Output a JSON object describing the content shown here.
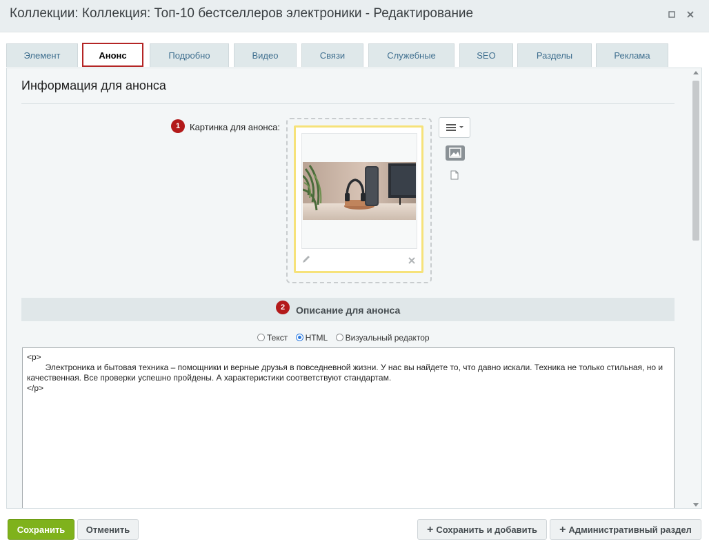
{
  "window": {
    "title": "Коллекции: Коллекция: Топ-10 бестселлеров электроники - Редактирование",
    "restore_glyph": "▫",
    "close_glyph": "✕"
  },
  "tabs": [
    {
      "label": "Элемент"
    },
    {
      "label": "Анонс",
      "active": true
    },
    {
      "label": "Подробно"
    },
    {
      "label": "Видео"
    },
    {
      "label": "Связи"
    },
    {
      "label": "Служебные"
    },
    {
      "label": "SEO"
    },
    {
      "label": "Разделы"
    },
    {
      "label": "Реклама"
    }
  ],
  "section": {
    "heading": "Информация для анонса",
    "picture": {
      "badge": "1",
      "label": "Картинка для анонса:",
      "image_description": "Наушники и колонка на столе"
    },
    "description": {
      "badge": "2",
      "title": "Описание для анонса",
      "modes": {
        "text": "Текст",
        "html": "HTML",
        "visual": "Визуальный редактор",
        "selected": "html"
      },
      "content": "<p>\n\tЭлектроника и бытовая техника – помощники и верные друзья в повседневной жизни. У нас вы найдете то, что давно искали. Техника не только стильная, но и качественная. Все проверки успешно пройдены. А характеристики соответствуют стандартам.\n</p>"
    }
  },
  "buttons": {
    "save": "Сохранить",
    "cancel": "Отменить",
    "save_and_add": "Сохранить и добавить",
    "admin_section": "Административный раздел"
  },
  "colors": {
    "accent_green": "#7fb21c",
    "badge_red": "#b31a1a",
    "active_tab_border": "#b42525",
    "image_card_border": "#f6e27a"
  }
}
